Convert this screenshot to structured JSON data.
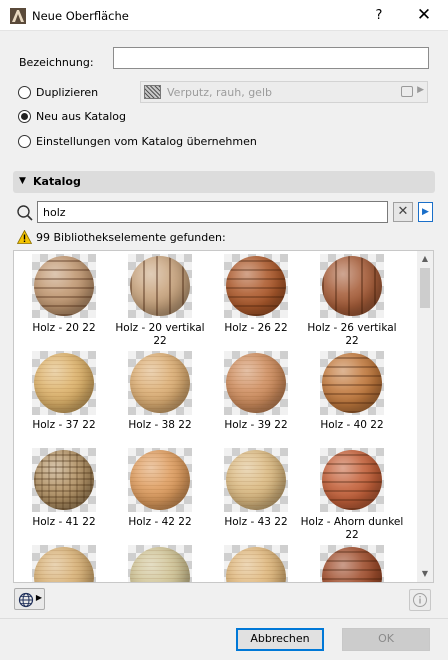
{
  "window": {
    "title": "Neue Oberfläche",
    "help_label": "?",
    "close_label": "✕"
  },
  "form": {
    "name_label": "Bezeichnung:",
    "name_value": "",
    "options": [
      {
        "label": "Duplizieren",
        "checked": false
      },
      {
        "label": "Neu aus Katalog",
        "checked": true
      },
      {
        "label": "Einstellungen vom Katalog übernehmen",
        "checked": false
      }
    ],
    "surface_value": "Verputz, rauh, gelb"
  },
  "catalog": {
    "section_title": "Katalog",
    "search_value": "holz",
    "clear_label": "✕",
    "go_label": "▶",
    "result_text": "99 Bibliothekselemente gefunden:",
    "items": [
      {
        "label": "Holz - 20 22",
        "color": "#c19872",
        "pattern": "striped"
      },
      {
        "label": "Holz - 20 vertikal 22",
        "color": "#c8a47e",
        "pattern": "vertical"
      },
      {
        "label": "Holz - 26 22",
        "color": "#ad5a2c",
        "pattern": "striped"
      },
      {
        "label": "Holz - 26 vertikal 22",
        "color": "#a75e3a",
        "pattern": "vertical"
      },
      {
        "label": "Holz - 37 22",
        "color": "#ddb26a",
        "pattern": "grainy"
      },
      {
        "label": "Holz - 38 22",
        "color": "#dcae74",
        "pattern": "grainy"
      },
      {
        "label": "Holz - 39 22",
        "color": "#cf8d5e",
        "pattern": "grainy"
      },
      {
        "label": "Holz - 40 22",
        "color": "#c27a3e",
        "pattern": "striped"
      },
      {
        "label": "Holz - 41 22",
        "color": "#b39366",
        "pattern": "checker"
      },
      {
        "label": "Holz - 42 22",
        "color": "#de9c5e",
        "pattern": "grainy"
      },
      {
        "label": "Holz - 43 22",
        "color": "#dbba82",
        "pattern": "grainy"
      },
      {
        "label": "Holz - Ahorn dunkel 22",
        "color": "#c4613a",
        "pattern": "striped"
      },
      {
        "label": "",
        "color": "#d8b176",
        "pattern": "grainy"
      },
      {
        "label": "",
        "color": "#cfc395",
        "pattern": "grainy"
      },
      {
        "label": "",
        "color": "#dfb77c",
        "pattern": "grainy"
      },
      {
        "label": "",
        "color": "#9f4d2c",
        "pattern": "striped"
      }
    ]
  },
  "buttons": {
    "cancel": "Abbrechen",
    "ok": "OK"
  }
}
